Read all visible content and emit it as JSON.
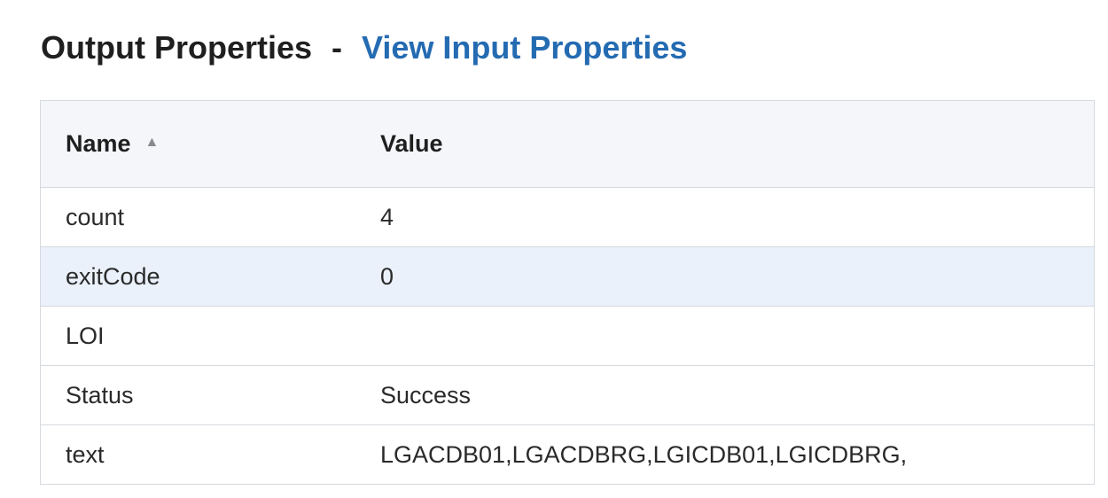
{
  "header": {
    "title": "Output Properties",
    "separator": "-",
    "link_label": "View Input Properties"
  },
  "table": {
    "columns": [
      {
        "label": "Name",
        "sort": "ascending",
        "sort_icon": "triangle-up-icon"
      },
      {
        "label": "Value"
      }
    ],
    "rows": [
      {
        "name": "count",
        "value": "4"
      },
      {
        "name": "exitCode",
        "value": "0",
        "highlighted": true
      },
      {
        "name": "LOI",
        "value": ""
      },
      {
        "name": "Status",
        "value": "Success"
      },
      {
        "name": "text",
        "value": "LGACDB01,LGACDBRG,LGICDB01,LGICDBRG,"
      }
    ]
  },
  "colors": {
    "link": "#246bb2",
    "header_bg": "#f4f6fa",
    "highlight_row_bg": "#eaf1fb",
    "border": "#d6d9de"
  }
}
